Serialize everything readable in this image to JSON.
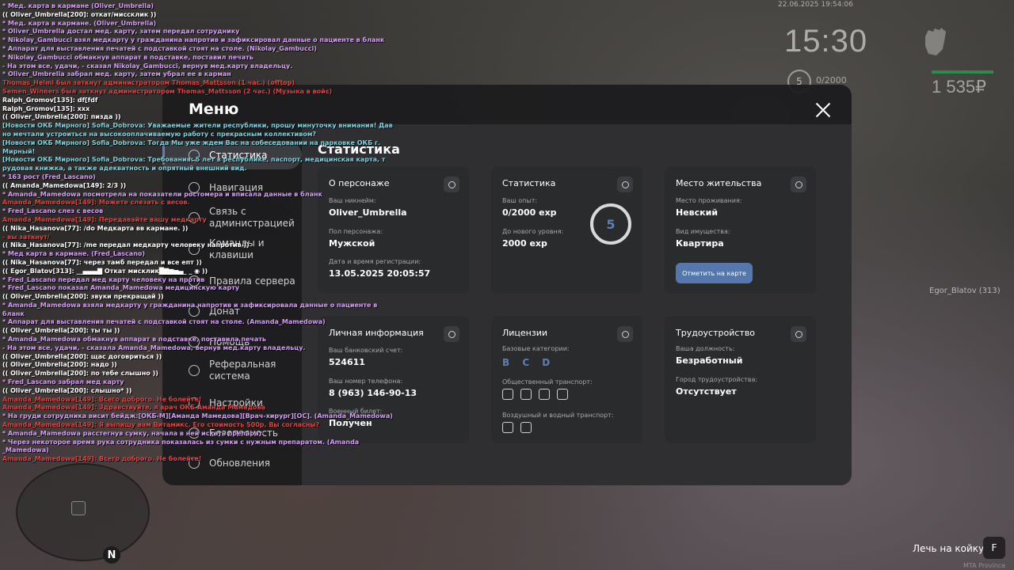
{
  "hud": {
    "datetime": "22.06.2025 19:54:06",
    "clock": "15:30",
    "level": "5",
    "exp": "0/2000",
    "money": "1 535₽",
    "nearby_player": "Egor_Blatov (313)",
    "action_label": "Лечь на койку",
    "action_key": "F",
    "watermark": "MTA Province",
    "compass": "N",
    "colors": {
      "health": "#2f8a49",
      "accent": "#5b7fba"
    }
  },
  "menu": {
    "title": "Меню",
    "nav": [
      {
        "label": "Статистика",
        "icon": "pie-chart-icon",
        "active": true
      },
      {
        "label": "Навигация",
        "icon": "compass-icon"
      },
      {
        "label": "Связь с администрацией",
        "icon": "chat-icon"
      },
      {
        "label": "Команды и клавиши",
        "icon": "keyboard-icon"
      },
      {
        "label": "Правила сервера",
        "icon": "rules-icon"
      },
      {
        "label": "Донат",
        "icon": "donate-icon"
      },
      {
        "label": "Помощь",
        "icon": "help-icon"
      },
      {
        "label": "Реферальная система",
        "icon": "referral-icon"
      },
      {
        "label": "Настройки",
        "icon": "gear-icon"
      },
      {
        "label": "Безопасность",
        "icon": "shield-icon"
      },
      {
        "label": "Обновления",
        "icon": "updates-icon"
      }
    ],
    "content_title": "Статистика",
    "cards": {
      "person": {
        "title": "О персонаже",
        "nick_label": "Ваш никнейм:",
        "nick": "Oliver_Umbrella",
        "sex_label": "Пол персонажа:",
        "sex": "Мужской",
        "reg_label": "Дата и время регистрации:",
        "reg": "13.05.2025 20:05:57"
      },
      "stats": {
        "title": "Статистика",
        "exp_label": "Ваш опыт:",
        "exp": "0/2000 exp",
        "next_label": "До нового уровня:",
        "next": "2000 exp",
        "level": "5"
      },
      "home": {
        "title": "Место жительства",
        "place_label": "Место проживания:",
        "place": "Невский",
        "prop_label": "Вид имущества:",
        "prop": "Квартира",
        "map_button": "Отметить на карте"
      },
      "personal": {
        "title": "Личная информация",
        "bank_label": "Ваш банковский счет:",
        "bank": "524611",
        "phone_label": "Ваш номер телефона:",
        "phone": "8 (963) 146-90-13",
        "military_label": "Военный билет:",
        "military": "Получен"
      },
      "licenses": {
        "title": "Лицензии",
        "base_label": "Базовые категории:",
        "base": "B C D",
        "public_label": "Общественный транспорт:",
        "air_label": "Воздушный и водный транспорт:"
      },
      "job": {
        "title": "Трудоустройство",
        "position_label": "Ваша должность:",
        "position": "Безработный",
        "city_label": "Город трудоустройства:",
        "city": "Отсутствует"
      }
    }
  },
  "chat": [
    {
      "c": "c-me",
      "t": "* Мед. карта в кармане (Oliver_Umbrella)"
    },
    {
      "c": "c-w",
      "t": "(( Oliver_Umbrella[200]: откат/миссклик ))"
    },
    {
      "c": "c-me",
      "t": "* Мед. карта в кармане. (Oliver_Umbrella)"
    },
    {
      "c": "c-me",
      "t": "* Oliver_Umbrella достал мед. карту, затем передал сотруднику"
    },
    {
      "c": "c-me",
      "t": "* Nikolay_Gambucci взял медкарту у гражданина напротив и зафиксировал данные о пациенте в бланк"
    },
    {
      "c": "c-me",
      "t": "* Аппарат для выставления печатей с подставкой стоят на столе. (Nikolay_Gambucci)"
    },
    {
      "c": "c-me",
      "t": "* Nikolay_Gambucci обмакнув аппарат в подставке, поставил печать"
    },
    {
      "c": "c-me",
      "t": "- На этом все, удачи, - сказал Nikolay_Gambucci, вернув мед.карту владельцу."
    },
    {
      "c": "c-me",
      "t": "* Oliver_Umbrella забрал мед. карту, затем убрал ее в карман"
    },
    {
      "c": "c-r",
      "t": "Thomas_Helmi был заткнут администратором Thomas_Mattsson (1 час.) (offtop)"
    },
    {
      "c": "c-r",
      "t": "Semen_Winners был заткнут администратором Thomas_Mattsson (2 час.) (Музыка в войс)"
    },
    {
      "c": "c-w",
      "t": "Ralph_Gromov[135]: df[fdf"
    },
    {
      "c": "c-w",
      "t": "Ralph_Gromov[135]: ххх"
    },
    {
      "c": "c-w",
      "t": "(( Oliver_Umbrella[200]: пизда ))"
    },
    {
      "c": "c-n",
      "t": "[Новости ОКБ Мирного] Sofia_Dobrova: Уважаемые жители республики, прошу минуточку внимания! Дав"
    },
    {
      "c": "c-n",
      "t": "но мечтали устроиться на высокооплачиваемую работу с прекрасным коллективом?"
    },
    {
      "c": "c-n",
      "t": "[Новости ОКБ Мирного] Sofia_Dobrova: Тогда Мы уже ждем Вас на собеседовании на парковке ОКБ г."
    },
    {
      "c": "c-n",
      "t": " Мирный!"
    },
    {
      "c": "c-n",
      "t": "[Новости ОКБ Мирного] Sofia_Dobrova: Требования: 5 лет в республике, паспорт, медицинская карта, т"
    },
    {
      "c": "c-n",
      "t": "рудовая книжка, а также адекватность и опрятный внешний вид."
    },
    {
      "c": "c-me",
      "t": "* 163 рост (Fred_Lascano)"
    },
    {
      "c": "c-w",
      "t": "(( Amanda_Mamedowa[149]: 2/3 ))"
    },
    {
      "c": "c-me",
      "t": "* Amanda_Mamedowa посмотрела  на показатели ростомера и вписала  данные в бланк"
    },
    {
      "c": "c-r",
      "t": "Amanda_Mamedowa[149]: Можете слезать с весов."
    },
    {
      "c": "c-me",
      "t": "* Fred_Lascano слез с весов"
    },
    {
      "c": "c-r",
      "t": "Amanda_Mamedowa[149]: Передавайте вашу медкарту"
    },
    {
      "c": "c-w",
      "t": "(( Nika_Hasanova[77]: /do Медкарта вв кармане. ))"
    },
    {
      "c": "c-r",
      "t": "- вы заткнут/"
    },
    {
      "c": "c-w",
      "t": "(( Nika_Hasanova[77]: /me передал медкарту человеку напротив ))"
    },
    {
      "c": "c-me",
      "t": "* Мед карта в кармане. (Fred_Lascano)"
    },
    {
      "c": "c-w",
      "t": "(( Nika_Hasanova[77]: через тамб передал и все епт ))"
    },
    {
      "c": "c-w",
      "t": "(( Egor_Blatov[313]: __▄▄▄▇ Откат мисклик█▇▆▅▄_ _ ◉ ))"
    },
    {
      "c": "c-me",
      "t": "* Fred_Lascano передал мед карту человеку на против"
    },
    {
      "c": "c-me",
      "t": "* Fred_Lascano показал Amanda_Mamedowa медицинскую карту"
    },
    {
      "c": "c-w",
      "t": "(( Oliver_Umbrella[200]: звуки прекращай ))"
    },
    {
      "c": "c-me",
      "t": "* Amanda_Mamedowa взяла  медкарту у гражданина напротив и зафиксировала  данные о пациенте в"
    },
    {
      "c": "c-me",
      "t": " бланк"
    },
    {
      "c": "c-me",
      "t": "* Аппарат для выставления печатей с подставкой стоят на столе. (Amanda_Mamedowa)"
    },
    {
      "c": "c-w",
      "t": "(( Oliver_Umbrella[200]: ты ты ))"
    },
    {
      "c": "c-me",
      "t": "* Amanda_Mamedowa обмакнув аппарат в подставке, поставила  печать"
    },
    {
      "c": "c-me",
      "t": "- На этом все, удачи, - сказала Amanda_Mamedowa, вернув мед.карту владельцу."
    },
    {
      "c": "c-w",
      "t": "(( Oliver_Umbrella[200]: щас договриться ))"
    },
    {
      "c": "c-w",
      "t": "(( Oliver_Umbrella[200]: надо ))"
    },
    {
      "c": "c-w",
      "t": "(( Oliver_Umbrella[200]: по тебе слышно ))"
    },
    {
      "c": "c-me",
      "t": "* Fred_Lascano забрал мед карту"
    },
    {
      "c": "c-w",
      "t": "(( Oliver_Umbrella[200]: слышно* ))"
    },
    {
      "c": "c-r",
      "t": "Amanda_Mamedowa[149]: Всего доброго. Не болейте!"
    },
    {
      "c": "c-r",
      "t": "Amanda_Mamedowa[149]: Здравствуйте, я врач ОКБ Аманда Мамедова"
    },
    {
      "c": "c-me",
      "t": "* На груди сотрудника висит бейдж:[ОКБ-М][Аманда Мамедова][Врач-хирург][ОС]. (Amanda_Mamedowa)"
    },
    {
      "c": "c-r",
      "t": "Amanda_Mamedowa[149]: Я выпишу вам Витамикс. Его стоимость 500р. Вы согласны?"
    },
    {
      "c": "c-me",
      "t": "* Amanda_Mamedowa расстегнув сумку, начала  в ней искать препарат"
    },
    {
      "c": "c-me",
      "t": "* Через некоторое время рука сотрудника показалась из сумки с нужным препаратом. (Amanda"
    },
    {
      "c": "c-me",
      "t": " _Mamedowa)"
    },
    {
      "c": "c-r",
      "t": "Amanda_Mamedowa[149]: Всего доброго. Не болейте!"
    }
  ]
}
